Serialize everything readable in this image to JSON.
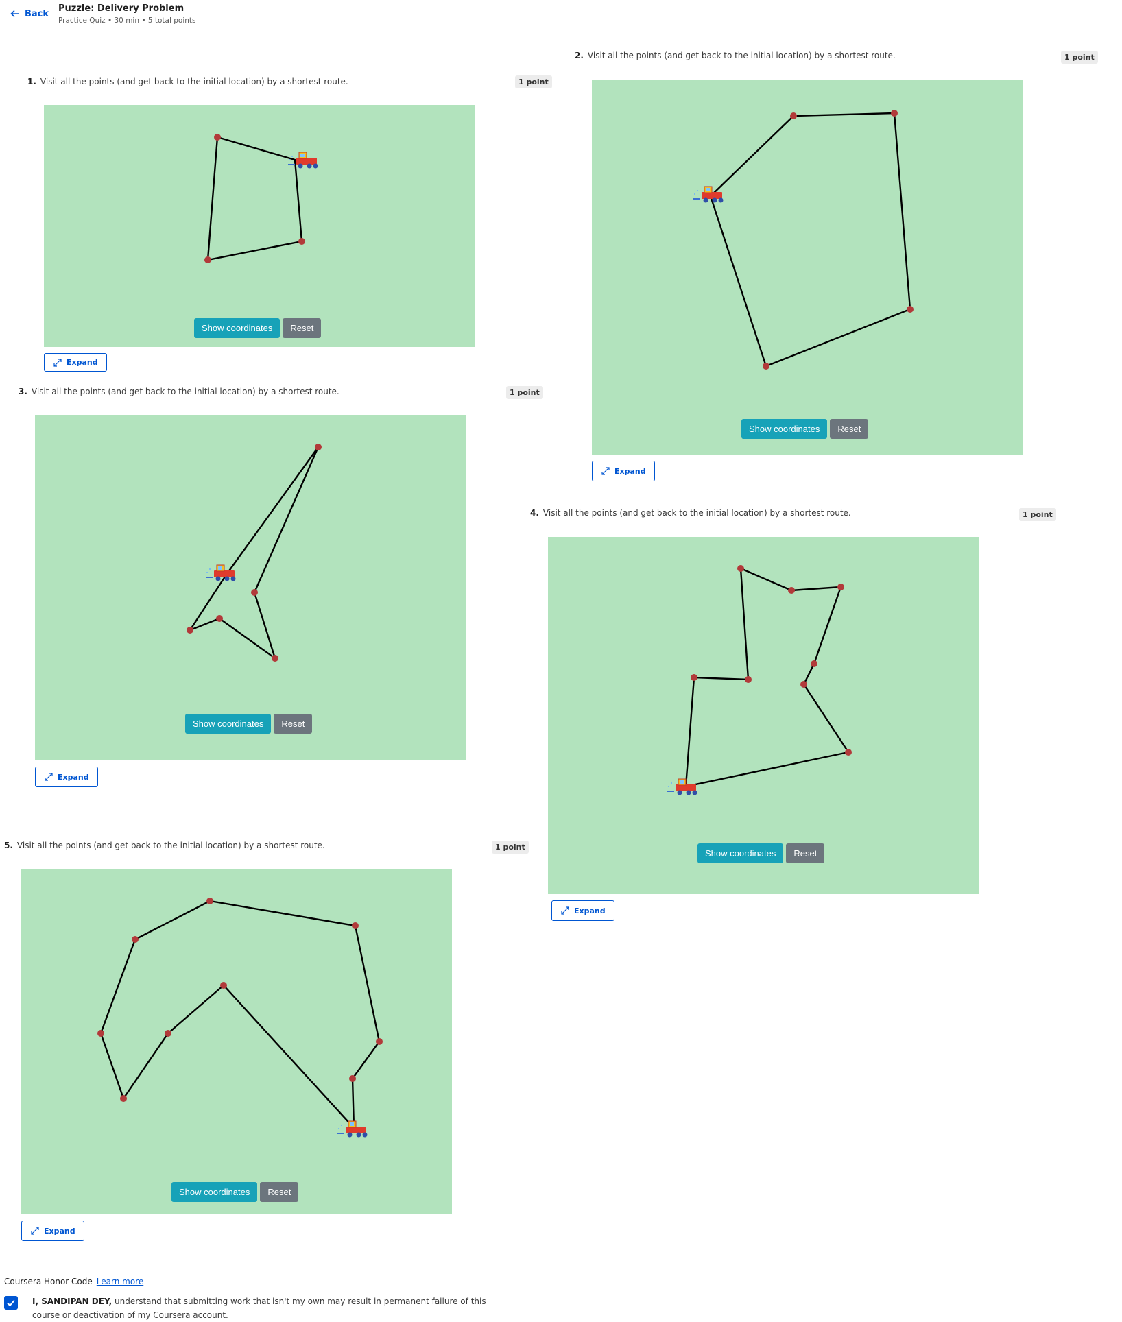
{
  "header": {
    "back_label": "Back",
    "title": "Puzzle: Delivery Problem",
    "subtitle": "Practice Quiz • 30 min • 5 total points"
  },
  "questions": [
    {
      "number": "1.",
      "text": "Visit all the points (and get back to the initial location) by a shortest route.",
      "points": "1 point",
      "show_label": "Show coordinates",
      "reset_label": "Reset",
      "expand_label": "Expand"
    },
    {
      "number": "2.",
      "text": "Visit all the points (and get back to the initial location) by a shortest route.",
      "points": "1 point",
      "show_label": "Show coordinates",
      "reset_label": "Reset",
      "expand_label": "Expand"
    },
    {
      "number": "3.",
      "text": "Visit all the points (and get back to the initial location) by a shortest route.",
      "points": "1 point",
      "show_label": "Show coordinates",
      "reset_label": "Reset",
      "expand_label": "Expand"
    },
    {
      "number": "4.",
      "text": "Visit all the points (and get back to the initial location) by a shortest route.",
      "points": "1 point",
      "show_label": "Show coordinates",
      "reset_label": "Reset",
      "expand_label": "Expand"
    },
    {
      "number": "5.",
      "text": "Visit all the points (and get back to the initial location) by a shortest route.",
      "points": "1 point",
      "show_label": "Show coordinates",
      "reset_label": "Reset",
      "expand_label": "Expand"
    }
  ],
  "honor": {
    "title": "Coursera Honor Code",
    "learn_more": "Learn more",
    "name": "I, SANDIPAN DEY,",
    "statement": " understand that submitting work that isn't my own may result in permanent failure of this course or deactivation of my Coursera account.",
    "checked": true
  },
  "colors": {
    "canvas": "#b2e3bd",
    "point": "#b23a3a",
    "route": "#000000",
    "show_button": "#17a2b8",
    "reset_button": "#6c757d",
    "link": "#0056d2"
  },
  "icons": {
    "back": "arrow-left-icon",
    "expand": "expand-arrows-icon",
    "truck": "delivery-truck-icon",
    "checkbox": "checkmark-icon"
  }
}
